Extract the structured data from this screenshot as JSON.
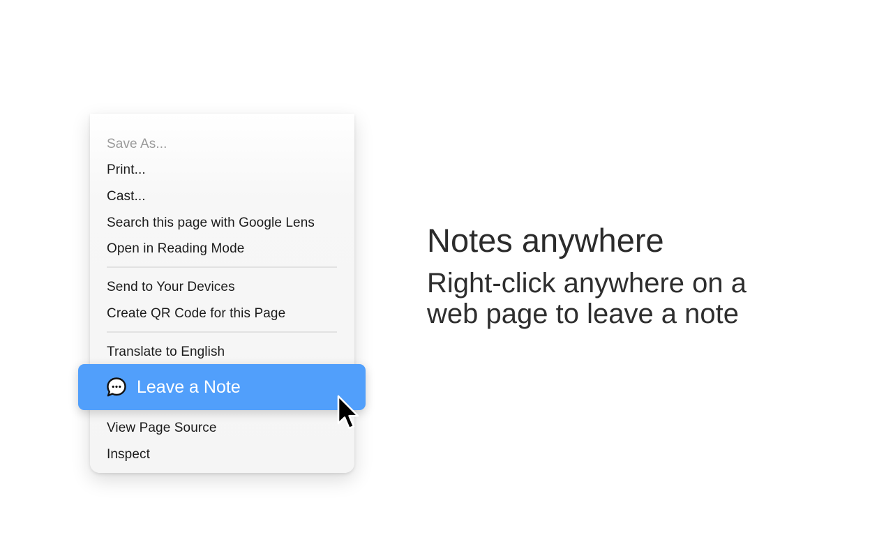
{
  "menu": {
    "items": [
      {
        "label": "Save As...",
        "state": "disabled"
      },
      {
        "label": "Print..."
      },
      {
        "label": "Cast..."
      },
      {
        "label": "Search this page with Google Lens"
      },
      {
        "label": "Open in Reading Mode"
      },
      {
        "label": "Send to Your Devices"
      },
      {
        "label": "Create QR Code for this Page"
      },
      {
        "label": "Translate to English"
      },
      {
        "label": "View Page Source"
      },
      {
        "label": "Inspect"
      }
    ],
    "highlighted_item": {
      "label": "Leave a Note",
      "icon": "speech-bubble-icon",
      "color": "#519ffb"
    }
  },
  "promo": {
    "headline": "Notes anywhere",
    "subline": "Right-click anywhere on a web page to leave a note"
  }
}
